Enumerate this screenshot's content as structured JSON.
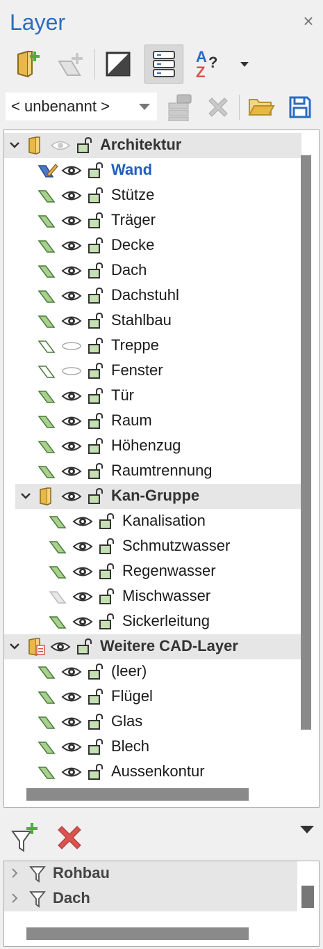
{
  "panel": {
    "title": "Layer",
    "close_glyph": "×"
  },
  "toolbar": {
    "icons": [
      "new-layer-group-icon",
      "new-layer-icon",
      "layer-color-icon",
      "layer-list-view-icon",
      "sort-alphabetical-icon",
      "dropdown-arrow-icon"
    ],
    "sort_glyph_a": "A",
    "sort_glyph_z": "Z",
    "sort_glyph_q": "?"
  },
  "layer_set": {
    "selected": "< unbenannt >",
    "icons": [
      "layer-database-icon",
      "delete-icon",
      "open-folder-icon",
      "save-icon"
    ]
  },
  "tree": {
    "groups": {
      "architektur": "Architektur",
      "kan_gruppe": "Kan-Gruppe",
      "weitere": "Weitere CAD-Layer"
    },
    "architektur_layers": [
      "Wand",
      "Stütze",
      "Träger",
      "Decke",
      "Dach",
      "Dachstuhl",
      "Stahlbau",
      "Treppe",
      "Fenster",
      "Tür",
      "Raum",
      "Höhenzug",
      "Raumtrennung"
    ],
    "kan_layers": [
      "Kanalisation",
      "Schmutzwasser",
      "Regenwasser",
      "Mischwasser",
      "Sickerleitung"
    ],
    "weitere_layers": [
      "(leer)",
      "Flügel",
      "Glas",
      "Blech",
      "Aussenkontur"
    ],
    "active_layer": "Wand",
    "hidden_layers": [
      "Treppe",
      "Fenster"
    ]
  },
  "filters": {
    "items": [
      "Rohbau",
      "Dach"
    ],
    "icons": [
      "filter-add-icon",
      "delete-icon",
      "filter-icon"
    ]
  },
  "colors": {
    "accent": "#2a6cc0",
    "layer_green": "#a9d18e",
    "lock_green": "#70ad47",
    "delete_red": "#d9534f"
  }
}
